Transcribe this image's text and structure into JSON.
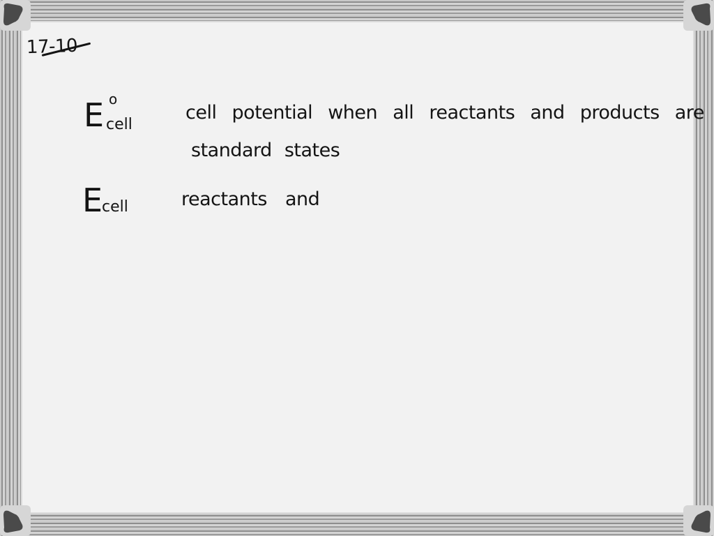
{
  "board": {
    "heading": "17-10",
    "entries": [
      {
        "symbol": "E",
        "superscript": "o",
        "subscript": "cell",
        "definition_lines": [
          "cell potential when all reactants and products are in",
          "standard states"
        ]
      },
      {
        "symbol": "E",
        "superscript": "",
        "subscript": "cell",
        "definition_lines": [
          "reactants and"
        ]
      }
    ]
  },
  "frame": {
    "surface_color": "#f2f2f2",
    "rail_color": "#a8a8a8",
    "corner_cap_color": "#4a4a4a",
    "ink_color": "#141414"
  }
}
